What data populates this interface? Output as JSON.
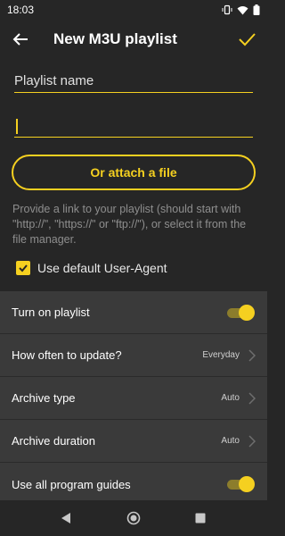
{
  "status_bar": {
    "time": "18:03",
    "icons": [
      "vibrate-icon",
      "wifi-icon",
      "battery-icon"
    ]
  },
  "toolbar": {
    "title": "New M3U playlist",
    "back_icon": "arrow-left-icon",
    "confirm_icon": "check-icon"
  },
  "form": {
    "name_placeholder": "Playlist name",
    "url_value": "",
    "attach_button_label": "Or attach a file",
    "help_text": "Provide a link to your playlist (should start with \"http://\", \"https://\" or \"ftp://\"), or select it from the file manager.",
    "user_agent_label": "Use default User-Agent",
    "user_agent_checked": true
  },
  "settings": [
    {
      "label": "Turn on playlist",
      "type": "toggle",
      "on": true
    },
    {
      "label": "How often to update?",
      "type": "select",
      "value": "Everyday"
    },
    {
      "label": "Archive type",
      "type": "select",
      "value": "Auto"
    },
    {
      "label": "Archive duration",
      "type": "select",
      "value": "Auto"
    },
    {
      "label": "Use all program guides",
      "type": "toggle",
      "on": true
    }
  ],
  "colors": {
    "accent": "#f5d020",
    "background": "#262626",
    "list_background": "#3a3a3a",
    "hint_text": "#8e8e8e"
  },
  "nav_bar": {
    "icons": [
      "back-triangle-icon",
      "home-circle-icon",
      "recents-square-icon"
    ]
  }
}
